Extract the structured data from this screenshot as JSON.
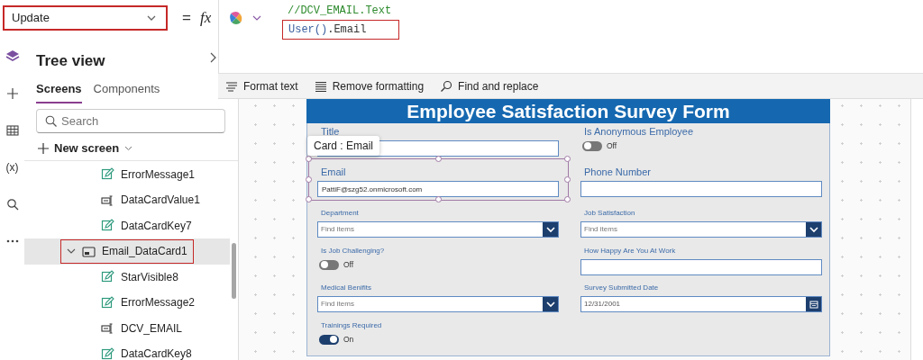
{
  "property_selector": {
    "value": "Update",
    "annotated": true
  },
  "formula_bar": {
    "equals": "=",
    "fx": "fx",
    "lines": [
      {
        "annotated": false,
        "tokens": [
          {
            "text": "//DCV_EMAIL.Text",
            "kind": "comment"
          }
        ]
      },
      {
        "annotated": true,
        "tokens": [
          {
            "text": "User()",
            "kind": "function"
          },
          {
            "text": ".Email",
            "kind": "plain"
          }
        ]
      }
    ]
  },
  "toolbar": [
    {
      "label": "Format text",
      "kind": "format"
    },
    {
      "label": "Remove formatting",
      "kind": "remove"
    },
    {
      "label": "Find and replace",
      "kind": "find"
    }
  ],
  "rail": [
    {
      "kind": "layers"
    },
    {
      "kind": "plus"
    },
    {
      "kind": "table"
    },
    {
      "kind": "variables",
      "glyph": "(x)"
    },
    {
      "kind": "search"
    },
    {
      "kind": "more"
    }
  ],
  "tree_view": {
    "title": "Tree view",
    "tabs": [
      {
        "label": "Screens",
        "selected": true
      },
      {
        "label": "Components",
        "selected": false
      }
    ],
    "search": {
      "placeholder": "Search"
    },
    "new_screen": "New screen",
    "items": [
      {
        "children": [
          {
            "label": "ErrorMessage1",
            "kind": "label",
            "selected": false,
            "annotated": false
          },
          {
            "label": "DataCardValue1",
            "kind": "input",
            "selected": false,
            "annotated": false
          },
          {
            "label": "DataCardKey7",
            "kind": "label",
            "selected": false,
            "annotated": false
          }
        ]
      },
      {
        "label": "Email_DataCard1",
        "kind": "card",
        "selected": true,
        "annotated": true,
        "expanded": true,
        "children": [
          {
            "label": "StarVisible8",
            "kind": "label",
            "selected": false,
            "annotated": false
          },
          {
            "label": "ErrorMessage2",
            "kind": "label",
            "selected": false,
            "annotated": false
          },
          {
            "label": "DCV_EMAIL",
            "kind": "input",
            "selected": false,
            "annotated": false
          },
          {
            "label": "DataCardKey8",
            "kind": "label",
            "selected": false,
            "annotated": false
          }
        ]
      }
    ]
  },
  "form": {
    "title": "Employee Satisfaction Survey Form",
    "selection_tooltip": "Card : Email",
    "columns": [
      {
        "fields": [
          {
            "label": "Title",
            "kind": "text",
            "selected": false
          },
          {
            "label": "Email",
            "kind": "text",
            "value": "PattiF@szg52.onmicrosoft.com",
            "selected": true
          },
          {
            "label": "Department",
            "kind": "dropdown",
            "placeholder": "Find items",
            "selected": false
          },
          {
            "label": "Is Job Challenging?",
            "kind": "toggle",
            "on": false,
            "value": "Off",
            "selected": false
          },
          {
            "label": "Medical Benifits",
            "kind": "dropdown",
            "placeholder": "Find items",
            "selected": false
          },
          {
            "label": "Trainings Required",
            "kind": "toggle",
            "on": true,
            "value": "On",
            "selected": false
          }
        ]
      },
      {
        "fields": [
          {
            "label": "Is Anonymous Employee",
            "kind": "toggle",
            "on": false,
            "value": "Off",
            "selected": false
          },
          {
            "label": "Phone Number",
            "kind": "text",
            "selected": false
          },
          {
            "label": "Job Satisfaction",
            "kind": "dropdown",
            "placeholder": "Find items",
            "selected": false
          },
          {
            "label": "How Happy Are You At Work",
            "kind": "text",
            "selected": false
          },
          {
            "label": "Survey Submitted Date",
            "kind": "date",
            "value": "12/31/2001",
            "selected": false
          }
        ]
      }
    ]
  }
}
